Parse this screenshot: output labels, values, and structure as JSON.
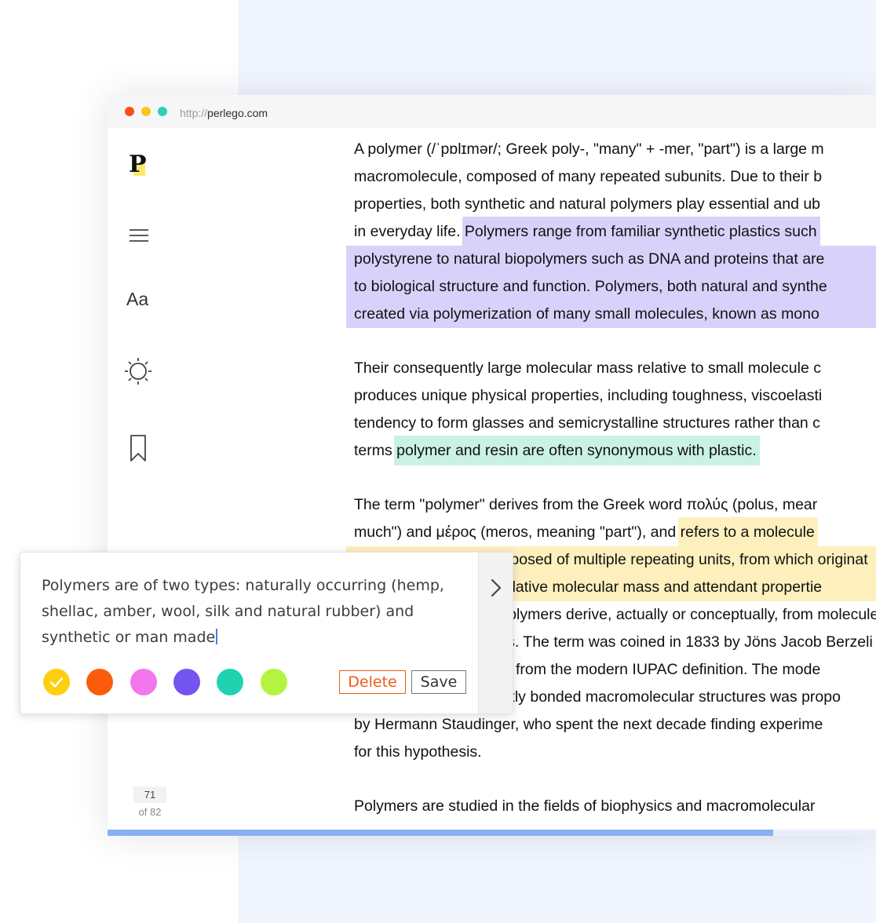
{
  "browser": {
    "url_protocol": "http://",
    "url_host": "perlego.com",
    "traffic_lights": [
      "#fc4d1a",
      "#fcc51a",
      "#2fd0b1"
    ]
  },
  "sidebar": {
    "logo_letter": "P",
    "menu_icon": "hamburger-icon",
    "font_settings_label": "Aa",
    "brightness_icon": "sun-icon",
    "bookmark_icon": "bookmark-icon",
    "page_current": "71",
    "page_total": "of 82",
    "progress_fraction": 0.866
  },
  "reader": {
    "paragraphs": [
      {
        "lines": [
          [
            {
              "text": "A polymer (/ˈpɒlɪmər/; Greek poly-, \"many\" + -mer, \"part\") is a large m",
              "hl": ""
            }
          ],
          [
            {
              "text": "macromolecule, composed of many repeated subunits. Due to their b",
              "hl": ""
            }
          ],
          [
            {
              "text": "properties, both synthetic and natural polymers play essential and ub",
              "hl": ""
            }
          ],
          [
            {
              "text": "in everyday life. ",
              "hl": ""
            },
            {
              "text": "Polymers range from familiar synthetic plastics such",
              "hl": "p"
            }
          ],
          [
            {
              "text": "polystyrene to natural biopolymers such as DNA and proteins that are",
              "hl": "p"
            }
          ],
          [
            {
              "text": "to biological structure and function. Polymers, both natural and synthe",
              "hl": "p"
            }
          ],
          [
            {
              "text": "created via polymerization of many small molecules, known as mono",
              "hl": "p"
            }
          ]
        ]
      },
      {
        "lines": [
          [
            {
              "text": "Their consequently large molecular mass relative to small molecule c",
              "hl": ""
            }
          ],
          [
            {
              "text": "produces unique physical properties, including toughness, viscoelasti",
              "hl": ""
            }
          ],
          [
            {
              "text": "tendency to form glasses and semicrystalline structures rather than c",
              "hl": ""
            }
          ],
          [
            {
              "text": "terms ",
              "hl": ""
            },
            {
              "text": "polymer and resin are often synonymous with plastic.",
              "hl": "t"
            }
          ]
        ]
      },
      {
        "lines": [
          [
            {
              "text": "The term \"polymer\" derives from the Greek word πολύς (polus, mear",
              "hl": ""
            }
          ],
          [
            {
              "text": "much\") and μέρος (meros, meaning \"part\"), and ",
              "hl": ""
            },
            {
              "text": "refers to a molecule",
              "hl": "y"
            }
          ],
          [
            {
              "text": "whose structure is composed of multiple repeating units, from which originat",
              "hl": "y"
            }
          ],
          [
            {
              "text": "characteristic of high relative molecular mass and attendant propertie",
              "hl": "y"
            }
          ],
          [
            {
              "text": "The units composing polymers derive, actually or conceptually, from molecules",
              "hl": ""
            }
          ],
          [
            {
              "text": "relative molecular mass. The term was coined in 1833 by Jöns Jacob Berzeli",
              "hl": ""
            }
          ],
          [
            {
              "text": "with a definition distinct from the modern IUPAC definition. The mode",
              "hl": ""
            }
          ],
          [
            {
              "text": "of polymers as covalently bonded macromolecular structures was propo",
              "hl": ""
            }
          ],
          [
            {
              "text": "by Hermann Staudinger, who spent the next decade finding experime",
              "hl": ""
            }
          ],
          [
            {
              "text": "for this hypothesis.",
              "hl": ""
            }
          ]
        ]
      },
      {
        "lines": [
          [
            {
              "text": "Polymers are studied in the fields of biophysics and macromolecular",
              "hl": ""
            }
          ]
        ]
      }
    ]
  },
  "note_popup": {
    "note_text": "Polymers are of two types: naturally occurring (hemp, shellac, amber, wool, silk and natural rubber) and synthetic or man made",
    "note_lines": [
      "Polymers are of two types: naturally occurring (hemp,",
      "shellac, amber, wool, silk and natural rubber) and",
      "synthetic or man made"
    ],
    "colors": [
      "#fcd00f",
      "#fb5c0c",
      "#f277ec",
      "#7354ef",
      "#1fd3b0",
      "#b4f33f"
    ],
    "selected_color_index": 0,
    "delete_label": "Delete",
    "save_label": "Save",
    "next_icon": "chevron-right-icon"
  }
}
